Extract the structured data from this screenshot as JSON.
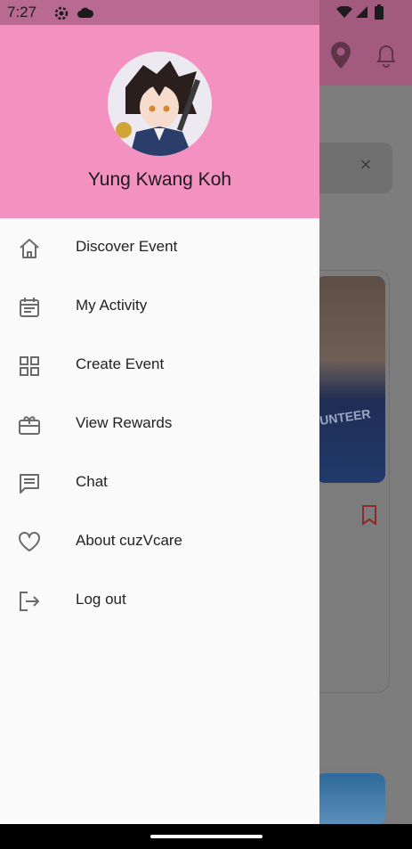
{
  "status_bar": {
    "time": "7:27"
  },
  "drawer": {
    "user_name": "Yung Kwang Koh",
    "menu": [
      {
        "label": "Discover Event",
        "icon": "home-icon"
      },
      {
        "label": "My Activity",
        "icon": "calendar-icon"
      },
      {
        "label": "Create Event",
        "icon": "grid-icon"
      },
      {
        "label": "View Rewards",
        "icon": "gift-card-icon"
      },
      {
        "label": "Chat",
        "icon": "chat-icon"
      },
      {
        "label": "About cuzVcare",
        "icon": "heart-icon"
      },
      {
        "label": "Log out",
        "icon": "logout-icon"
      }
    ]
  },
  "background_app": {
    "close_glyph": "×",
    "card_image_text": "UNTEER"
  },
  "colors": {
    "drawer_header": "#f391c0",
    "icon_gray": "#6b6b6b"
  }
}
